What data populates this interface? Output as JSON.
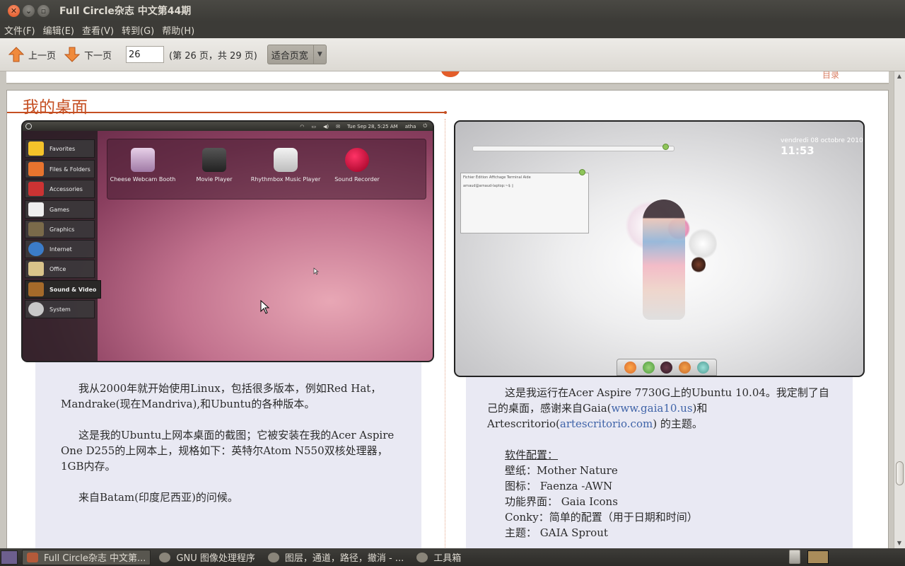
{
  "window": {
    "title": "Full Circle杂志 中文第44期"
  },
  "menu": [
    "文件(F)",
    "编辑(E)",
    "查看(V)",
    "转到(G)",
    "帮助(H)"
  ],
  "toolbar": {
    "prev_label": "上一页",
    "next_label": "下一页",
    "page_value": "26",
    "page_info": "(第 26 页，共 29 页)",
    "zoom_label": "适合页宽",
    "zoom_dropdown": "▼"
  },
  "prev_page": {
    "fragment_text": "目录"
  },
  "page": {
    "section_title": "我的桌面",
    "left_screenshot": {
      "panel_time": "Tue Sep 28,  5:25 AM",
      "panel_user": "atha",
      "categories": [
        "Favorites",
        "Files & Folders",
        "Accessories",
        "Games",
        "Graphics",
        "Internet",
        "Office",
        "Sound & Video",
        "System"
      ],
      "selected_category": "Sound & Video",
      "apps": [
        {
          "name": "Cheese Webcam Booth"
        },
        {
          "name": "Movie Player"
        },
        {
          "name": "Rhythmbox Music Player"
        },
        {
          "name": "Sound Recorder"
        }
      ]
    },
    "right_screenshot": {
      "date": "vendredi 08 octobre 2010",
      "time": "11:53",
      "terminal_menu": "Fichier  Édition  Affichage  Terminal  Aide",
      "terminal_prompt": "arnaud@arnaud-laptop:~$ ▯"
    },
    "left_text": {
      "p1": "我从2000年就开始使用Linux，包括很多版本，例如Red Hat，Mandrake(现在Mandriva),和Ubuntu的各种版本。",
      "p2": "这是我的Ubuntu上网本桌面的截图；它被安装在我的Acer Aspire One D255的上网本上，规格如下：英特尔Atom N550双核处理器，1GB内存。",
      "p3": "来自Batam(印度尼西亚)的问候。"
    },
    "right_text": {
      "p1_a": "这是我运行在Acer Aspire 7730G上的Ubuntu 10.04。我定制了自己的桌面，感谢来自Gaia(",
      "link1": "www.gaia10.us",
      "p1_b": ")和Artescritorio(",
      "link2": "artescritorio.com",
      "p1_c": ") 的主题。",
      "config_heading": "软件配置：",
      "config": [
        "壁纸：Mother Nature",
        "图标： Faenza -AWN",
        "功能界面： Gaia Icons",
        "Conky：简单的配置（用于日期和时间）",
        "主题： GAIA Sprout"
      ]
    }
  },
  "taskbar": {
    "tasks": [
      {
        "label": "Full Circle杂志 中文第..."
      },
      {
        "label": "GNU 图像处理程序"
      },
      {
        "label": "图层，通道，路径，撤消 - ..."
      },
      {
        "label": "工具箱"
      }
    ]
  },
  "colors": {
    "accent_orange": "#c54f22",
    "link_blue": "#3f63a8",
    "panel_dark": "#3c3b37"
  }
}
